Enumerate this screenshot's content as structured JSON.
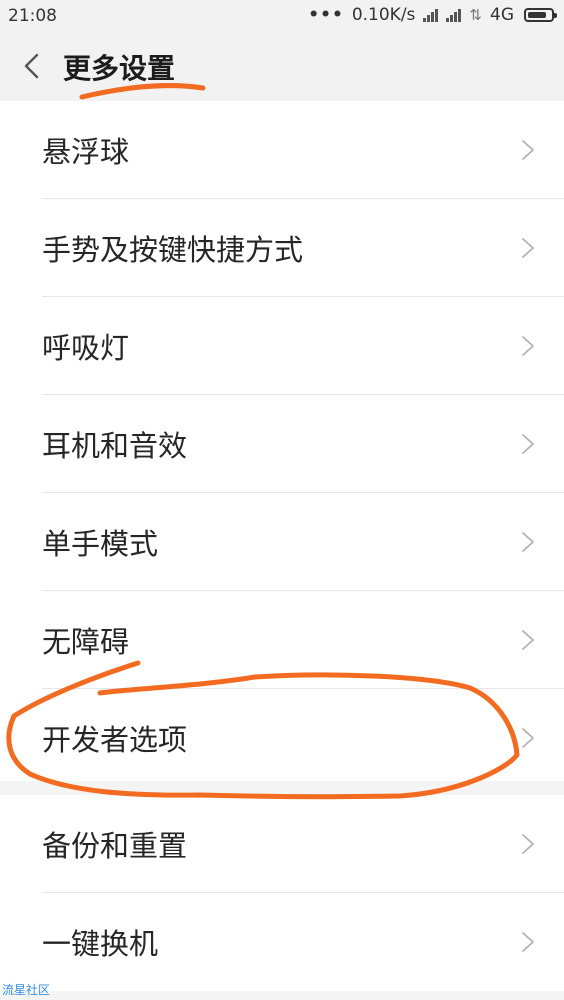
{
  "status_bar": {
    "time": "21:08",
    "dots": "•••",
    "net_speed": "0.10K/s",
    "arrows": "⇅",
    "network_type": "4G",
    "battery_level": 0.8
  },
  "header": {
    "title": "更多设置"
  },
  "settings": {
    "items": [
      {
        "label": "悬浮球"
      },
      {
        "label": "手势及按键快捷方式"
      },
      {
        "label": "呼吸灯"
      },
      {
        "label": "耳机和音效"
      },
      {
        "label": "单手模式"
      },
      {
        "label": "无障碍"
      },
      {
        "label": "开发者选项"
      }
    ]
  },
  "settings_more": {
    "items": [
      {
        "label": "备份和重置"
      },
      {
        "label": "一键换机"
      }
    ]
  },
  "annotation": {
    "color": "#f26b21"
  },
  "watermark": "流星社区"
}
